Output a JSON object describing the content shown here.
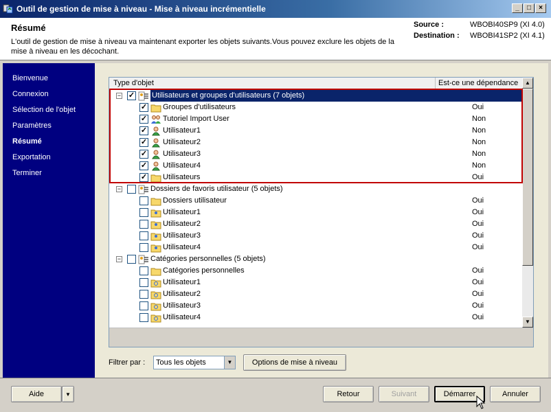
{
  "window": {
    "title": "Outil de gestion de mise à niveau - Mise à niveau incrémentielle",
    "icon": "app-icon"
  },
  "header": {
    "title": "Résumé",
    "description": "L'outil de gestion de mise à niveau va maintenant exporter les objets suivants.Vous pouvez exclure les objets de la mise à niveau en les décochant.",
    "source_label": "Source :",
    "source_value": "WBOBI40SP9 (XI 4.0)",
    "destination_label": "Destination :",
    "destination_value": "WBOBI41SP2 (XI 4.1)"
  },
  "sidebar": {
    "items": [
      {
        "label": "Bienvenue"
      },
      {
        "label": "Connexion"
      },
      {
        "label": "Sélection de l'objet"
      },
      {
        "label": "Paramètres"
      },
      {
        "label": "Résumé",
        "active": true
      },
      {
        "label": "Exportation"
      },
      {
        "label": "Terminer"
      }
    ]
  },
  "list": {
    "col_type": "Type d'objet",
    "col_dep": "Est-ce une dépendance",
    "rows": [
      {
        "level": 0,
        "label": "Utilisateurs et groupes d'utilisateurs (7 objets)",
        "checked": true,
        "icon": "users-groups-icon",
        "dep": "",
        "selected": true
      },
      {
        "level": 1,
        "label": "Groupes d'utilisateurs",
        "checked": true,
        "icon": "folder-icon",
        "dep": "Oui"
      },
      {
        "level": 1,
        "label": "Tutoriel Import User",
        "checked": true,
        "icon": "user-group-icon",
        "dep": "Non"
      },
      {
        "level": 1,
        "label": "Utilisateur1",
        "checked": true,
        "icon": "user-icon",
        "dep": "Non"
      },
      {
        "level": 1,
        "label": "Utilisateur2",
        "checked": true,
        "icon": "user-icon",
        "dep": "Non"
      },
      {
        "level": 1,
        "label": "Utilisateur3",
        "checked": true,
        "icon": "user-icon",
        "dep": "Non"
      },
      {
        "level": 1,
        "label": "Utilisateur4",
        "checked": true,
        "icon": "user-icon",
        "dep": "Non"
      },
      {
        "level": 1,
        "label": "Utilisateurs",
        "checked": true,
        "icon": "folder-icon",
        "dep": "Oui"
      },
      {
        "level": 0,
        "label": "Dossiers de favoris utilisateur (5 objets)",
        "checked": false,
        "icon": "favorites-folders-icon",
        "dep": ""
      },
      {
        "level": 1,
        "label": "Dossiers utilisateur",
        "checked": false,
        "icon": "folder-icon",
        "dep": "Oui"
      },
      {
        "level": 1,
        "label": "Utilisateur1",
        "checked": false,
        "icon": "user-folder-icon",
        "dep": "Oui"
      },
      {
        "level": 1,
        "label": "Utilisateur2",
        "checked": false,
        "icon": "user-folder-icon",
        "dep": "Oui"
      },
      {
        "level": 1,
        "label": "Utilisateur3",
        "checked": false,
        "icon": "user-folder-icon",
        "dep": "Oui"
      },
      {
        "level": 1,
        "label": "Utilisateur4",
        "checked": false,
        "icon": "user-folder-icon",
        "dep": "Oui"
      },
      {
        "level": 0,
        "label": "Catégories personnelles (5 objets)",
        "checked": false,
        "icon": "personal-categories-icon",
        "dep": ""
      },
      {
        "level": 1,
        "label": "Catégories personnelles",
        "checked": false,
        "icon": "folder-icon",
        "dep": "Oui"
      },
      {
        "level": 1,
        "label": "Utilisateur1",
        "checked": false,
        "icon": "category-icon",
        "dep": "Oui"
      },
      {
        "level": 1,
        "label": "Utilisateur2",
        "checked": false,
        "icon": "category-icon",
        "dep": "Oui"
      },
      {
        "level": 1,
        "label": "Utilisateur3",
        "checked": false,
        "icon": "category-icon",
        "dep": "Oui"
      },
      {
        "level": 1,
        "label": "Utilisateur4",
        "checked": false,
        "icon": "category-icon",
        "dep": "Oui"
      }
    ]
  },
  "filter": {
    "label": "Filtrer par :",
    "value": "Tous les objets",
    "options_button": "Options de mise à niveau"
  },
  "footer": {
    "help": "Aide",
    "back": "Retour",
    "next": "Suivant",
    "start": "Démarrer",
    "cancel": "Annuler"
  },
  "colors": {
    "sidebar_bg": "#000080",
    "selection": "#0a246a",
    "highlight_border": "#c00000"
  }
}
